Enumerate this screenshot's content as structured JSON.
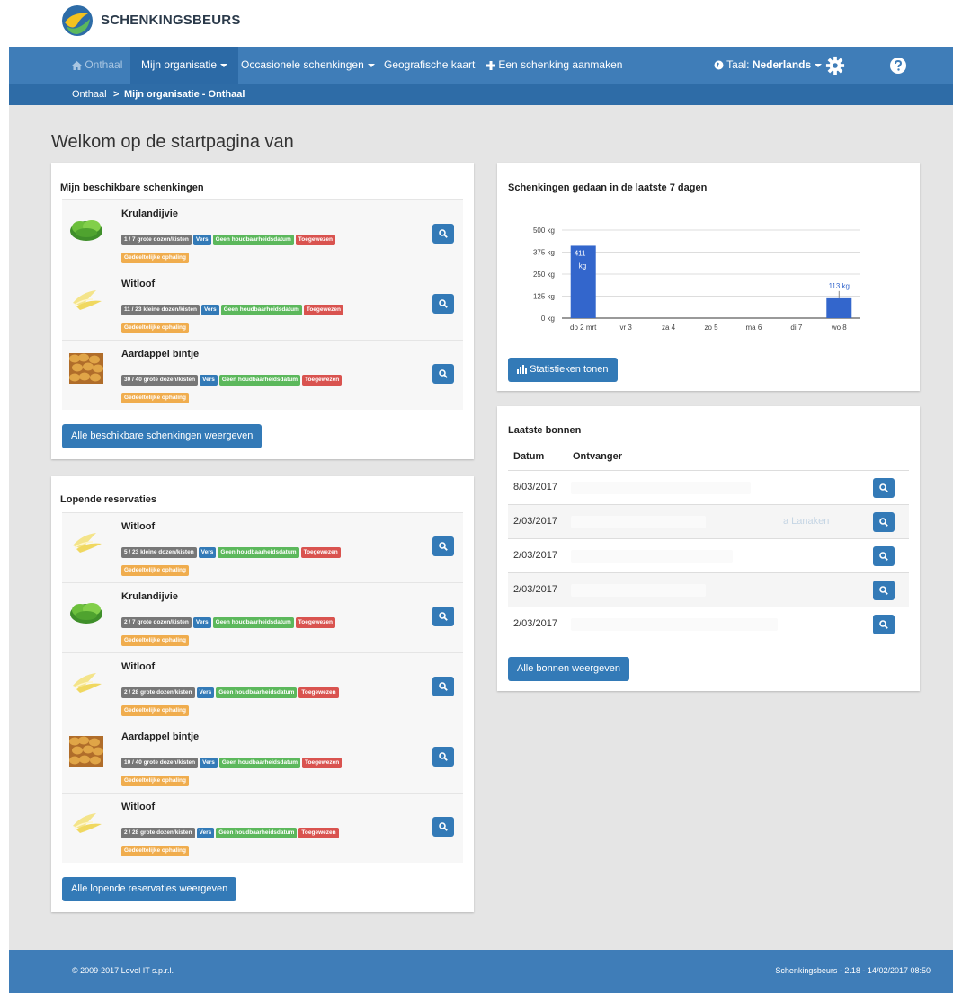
{
  "app": {
    "logo_text": "SCHENKINGSBEURS"
  },
  "nav": {
    "home": "Onthaal",
    "my_org": "Mijn organisatie",
    "occasional": "Occasionele schenkingen",
    "map": "Geografische kaart",
    "create": "Een schenking aanmaken",
    "lang_prefix": "Taal: ",
    "lang_value": "Nederlands"
  },
  "breadcrumb": {
    "home": "Onthaal",
    "separator": ">",
    "current": "Mijn organisatie - Onthaal"
  },
  "welcome": "Welkom op de startpagina van",
  "available": {
    "title": "Mijn beschikbare schenkingen",
    "items": [
      {
        "name": "Krulandijvie",
        "image": "lettuce",
        "qty": "1 / 7 grote dozen/kisten",
        "vers": "Vers",
        "date": "Geen houdbaarheidsdatum",
        "status": "Toegewezen",
        "pickup": "Gedeeltelijke ophaling"
      },
      {
        "name": "Witloof",
        "image": "endive",
        "qty": "11 / 23 kleine dozen/kisten",
        "vers": "Vers",
        "date": "Geen houdbaarheidsdatum",
        "status": "Toegewezen",
        "pickup": "Gedeeltelijke ophaling"
      },
      {
        "name": "Aardappel bintje",
        "image": "potatoes",
        "qty": "30 / 40 grote dozen/kisten",
        "vers": "Vers",
        "date": "Geen houdbaarheidsdatum",
        "status": "Toegewezen",
        "pickup": "Gedeeltelijke ophaling"
      }
    ],
    "button": "Alle beschikbare schenkingen weergeven"
  },
  "reservations": {
    "title": "Lopende reservaties",
    "items": [
      {
        "name": "Witloof",
        "image": "endive",
        "qty": "5 / 23 kleine dozen/kisten",
        "vers": "Vers",
        "date": "Geen houdbaarheidsdatum",
        "status": "Toegewezen",
        "pickup": "Gedeeltelijke ophaling"
      },
      {
        "name": "Krulandijvie",
        "image": "lettuce",
        "qty": "2 / 7 grote dozen/kisten",
        "vers": "Vers",
        "date": "Geen houdbaarheidsdatum",
        "status": "Toegewezen",
        "pickup": "Gedeeltelijke ophaling"
      },
      {
        "name": "Witloof",
        "image": "endive",
        "qty": "2 / 28 grote dozen/kisten",
        "vers": "Vers",
        "date": "Geen houdbaarheidsdatum",
        "status": "Toegewezen",
        "pickup": "Gedeeltelijke ophaling"
      },
      {
        "name": "Aardappel bintje",
        "image": "potatoes",
        "qty": "10 / 40 grote dozen/kisten",
        "vers": "Vers",
        "date": "Geen houdbaarheidsdatum",
        "status": "Toegewezen",
        "pickup": "Gedeeltelijke ophaling"
      },
      {
        "name": "Witloof",
        "image": "endive",
        "qty": "2 / 28 grote dozen/kisten",
        "vers": "Vers",
        "date": "Geen houdbaarheidsdatum",
        "status": "Toegewezen",
        "pickup": "Gedeeltelijke ophaling"
      }
    ],
    "button": "Alle lopende reservaties weergeven"
  },
  "chart_panel": {
    "title": "Schenkingen gedaan in de laatste 7 dagen",
    "button": "Statistieken tonen"
  },
  "chart_data": {
    "type": "bar",
    "categories": [
      "do 2 mrt",
      "vr 3",
      "za 4",
      "zo 5",
      "ma 6",
      "di 7",
      "wo 8"
    ],
    "values": [
      411,
      0,
      0,
      0,
      0,
      0,
      113
    ],
    "data_labels": [
      "411 kg",
      "",
      "",
      "",
      "",
      "",
      "113 kg"
    ],
    "yticks": [
      "0 kg",
      "125 kg",
      "250 kg",
      "375 kg",
      "500 kg"
    ],
    "ylim": [
      0,
      500
    ],
    "grid": true,
    "color": "#3366cc"
  },
  "receipts": {
    "title": "Laatste bonnen",
    "col_date": "Datum",
    "col_recipient": "Ontvanger",
    "rows": [
      {
        "date": "8/03/2017",
        "fragment": ""
      },
      {
        "date": "2/03/2017",
        "fragment": "a Lanaken"
      },
      {
        "date": "2/03/2017",
        "fragment": ""
      },
      {
        "date": "2/03/2017",
        "fragment": ""
      },
      {
        "date": "2/03/2017",
        "fragment": ""
      }
    ],
    "button": "Alle bonnen weergeven"
  },
  "footer": {
    "left": "© 2009-2017 Level IT s.p.r.l.",
    "right": "Schenkingsbeurs - 2.18 - 14/02/2017 08:50"
  },
  "colors": {
    "brand": "#3f7db8",
    "breadcrumb": "#2e6ca7",
    "primary": "#337ab7",
    "success": "#5cb85c",
    "danger": "#d9534f",
    "warning": "#f0ad4e",
    "neutral": "#777777"
  }
}
